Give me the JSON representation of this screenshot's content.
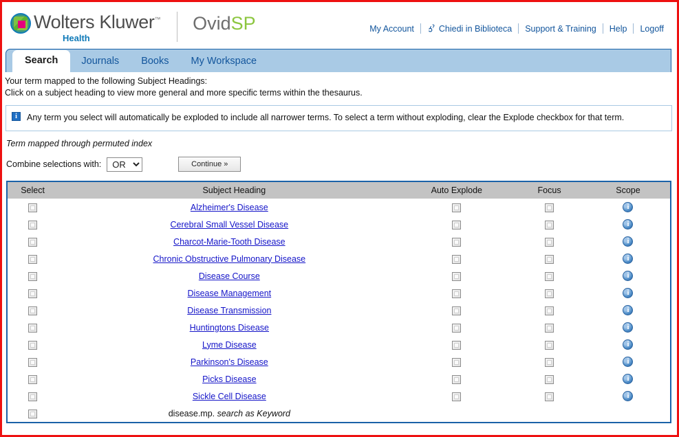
{
  "brand": {
    "name": "Wolters Kluwer",
    "trademark": "™",
    "sub": "Health",
    "product_prefix": "Ovid",
    "product_suffix": "SP",
    "logo_icon": "wolters-kluwer-globe-logo",
    "accent_blue": "#12559c",
    "accent_green": "#8cc63f",
    "logo_magenta": "#e5007d"
  },
  "topnav": {
    "items": [
      {
        "label": "My Account",
        "icon": ""
      },
      {
        "label": "Chiedi in Biblioteca",
        "icon": "ask-a-librarian-icon"
      },
      {
        "label": "Support & Training",
        "icon": ""
      },
      {
        "label": "Help",
        "icon": ""
      },
      {
        "label": "Logoff",
        "icon": ""
      }
    ]
  },
  "tabs": [
    {
      "label": "Search",
      "active": true
    },
    {
      "label": "Journals",
      "active": false
    },
    {
      "label": "Books",
      "active": false
    },
    {
      "label": "My Workspace",
      "active": false
    }
  ],
  "intro": {
    "line1": "Your term mapped to the following Subject Headings:",
    "line2": "Click on a subject heading to view more general and more specific terms within the thesaurus."
  },
  "notice": {
    "icon": "info-icon",
    "icon_glyph": "i",
    "text": "Any term you select will automatically be exploded to include all narrower terms. To select a term without exploding, clear the Explode checkbox for that term.",
    "border_color": "#a9c9e3"
  },
  "permuted_note": "Term mapped through permuted index",
  "combine": {
    "label": "Combine selections with:",
    "selected": "OR",
    "options": [
      "OR",
      "AND"
    ],
    "continue_label": "Continue »"
  },
  "table": {
    "columns": {
      "select": "Select",
      "heading": "Subject Heading",
      "explode": "Auto Explode",
      "focus": "Focus",
      "scope": "Scope"
    },
    "scope_icon": "scope-info-icon",
    "scope_glyph": "i",
    "rows": [
      {
        "heading": "Alzheimer's Disease",
        "is_link": true,
        "selected": false,
        "explode": false,
        "focus": false,
        "scope": true
      },
      {
        "heading": "Cerebral Small Vessel Disease",
        "is_link": true,
        "selected": false,
        "explode": false,
        "focus": false,
        "scope": true
      },
      {
        "heading": "Charcot-Marie-Tooth Disease",
        "is_link": true,
        "selected": false,
        "explode": false,
        "focus": false,
        "scope": true
      },
      {
        "heading": "Chronic Obstructive Pulmonary Disease",
        "is_link": true,
        "selected": false,
        "explode": false,
        "focus": false,
        "scope": true
      },
      {
        "heading": "Disease Course",
        "is_link": true,
        "selected": false,
        "explode": false,
        "focus": false,
        "scope": true
      },
      {
        "heading": "Disease Management",
        "is_link": true,
        "selected": false,
        "explode": false,
        "focus": false,
        "scope": true
      },
      {
        "heading": "Disease Transmission",
        "is_link": true,
        "selected": false,
        "explode": false,
        "focus": false,
        "scope": true
      },
      {
        "heading": "Huntingtons Disease",
        "is_link": true,
        "selected": false,
        "explode": false,
        "focus": false,
        "scope": true
      },
      {
        "heading": "Lyme Disease",
        "is_link": true,
        "selected": false,
        "explode": false,
        "focus": false,
        "scope": true
      },
      {
        "heading": "Parkinson's Disease",
        "is_link": true,
        "selected": false,
        "explode": false,
        "focus": false,
        "scope": true
      },
      {
        "heading": "Picks Disease",
        "is_link": true,
        "selected": false,
        "explode": false,
        "focus": false,
        "scope": true
      },
      {
        "heading": "Sickle Cell Disease",
        "is_link": true,
        "selected": false,
        "explode": false,
        "focus": false,
        "scope": true
      },
      {
        "heading": "disease.mp.",
        "heading_italic_suffix": "search as Keyword",
        "is_link": false,
        "selected": false,
        "explode": null,
        "focus": null,
        "scope": false
      }
    ]
  }
}
